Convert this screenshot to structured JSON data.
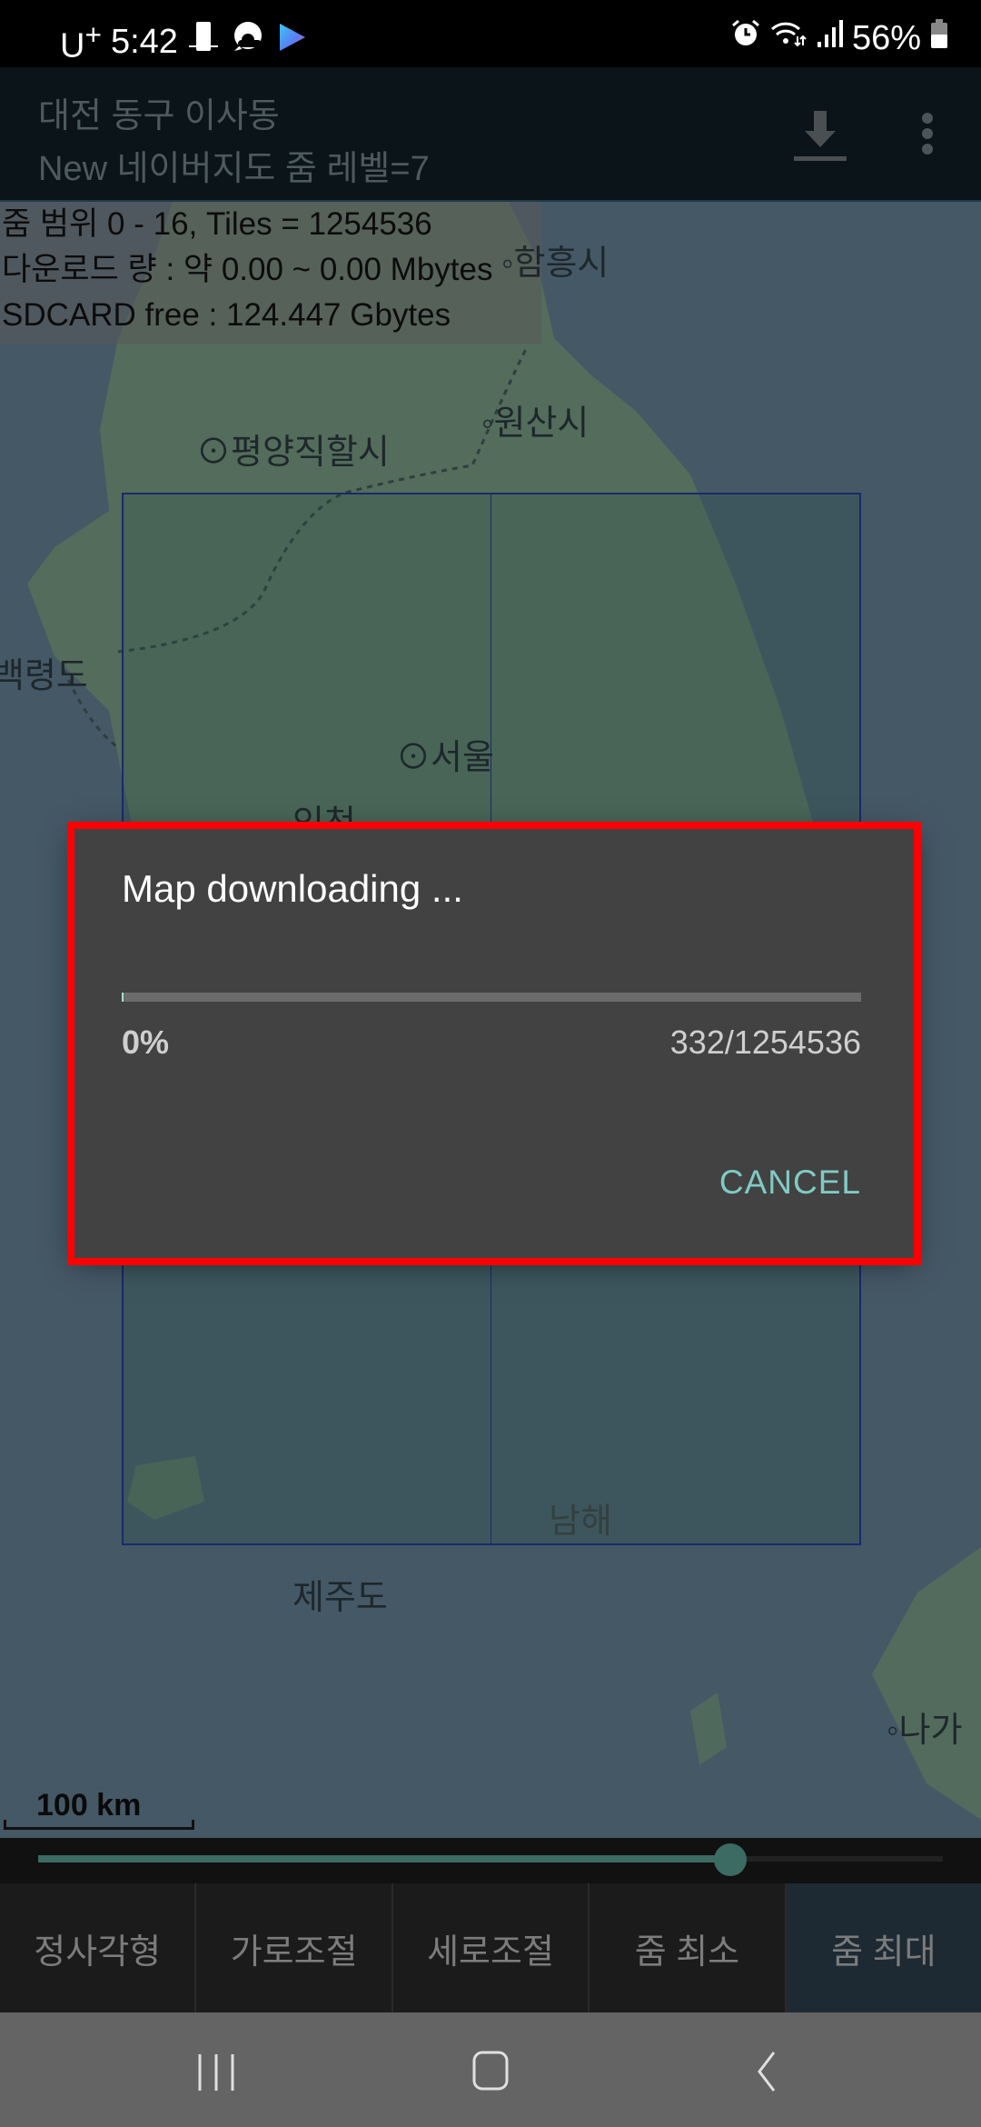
{
  "status_bar": {
    "carrier": "U",
    "carrier_sup": "+",
    "time": "5:42",
    "battery": "56%",
    "icons": [
      "device-icon",
      "weather-icon",
      "play-icon",
      "alarm-icon",
      "wifi-icon",
      "signal-icon",
      "battery-icon"
    ]
  },
  "app_bar": {
    "title": "대전 동구 이사동",
    "subtitle": "New 네이버지도 줌 레벨=7",
    "actions": [
      "download-icon",
      "more-options-icon"
    ]
  },
  "info_panel": {
    "line1": "줌 범위 0 - 16, Tiles = 1254536",
    "line2": "다운로드 량 : 약 0.00 ~ 0.00 Mbytes",
    "line3": "SDCARD free : 124.447 Gbytes"
  },
  "map": {
    "labels": {
      "hamhung": "함흥시",
      "wonsan": "원산시",
      "pyongyang": "평양직할시",
      "baengnyeong": "백령도",
      "seoul": "서울",
      "incheon": "인천",
      "namhae": "남해",
      "jeju": "제주도",
      "nagasaki": "나가"
    },
    "scale_label": "100 km"
  },
  "zoom_slider": {
    "value_fraction": 0.765
  },
  "dialog": {
    "title": "Map downloading ...",
    "progress_percent": 0,
    "percent_label": "0%",
    "count_label": "332/1254536",
    "cancel_label": "CANCEL"
  },
  "bottom_tabs": [
    {
      "label": "정사각형"
    },
    {
      "label": "가로조절"
    },
    {
      "label": "세로조절"
    },
    {
      "label": "줌 최소"
    },
    {
      "label": "줌 최대"
    }
  ],
  "nav_bar": {
    "buttons": [
      "recents-icon",
      "home-icon",
      "back-icon"
    ]
  },
  "colors": {
    "accent": "#80cbc4",
    "slider": "#3b6b63",
    "highlight_frame": "#ff0000"
  }
}
